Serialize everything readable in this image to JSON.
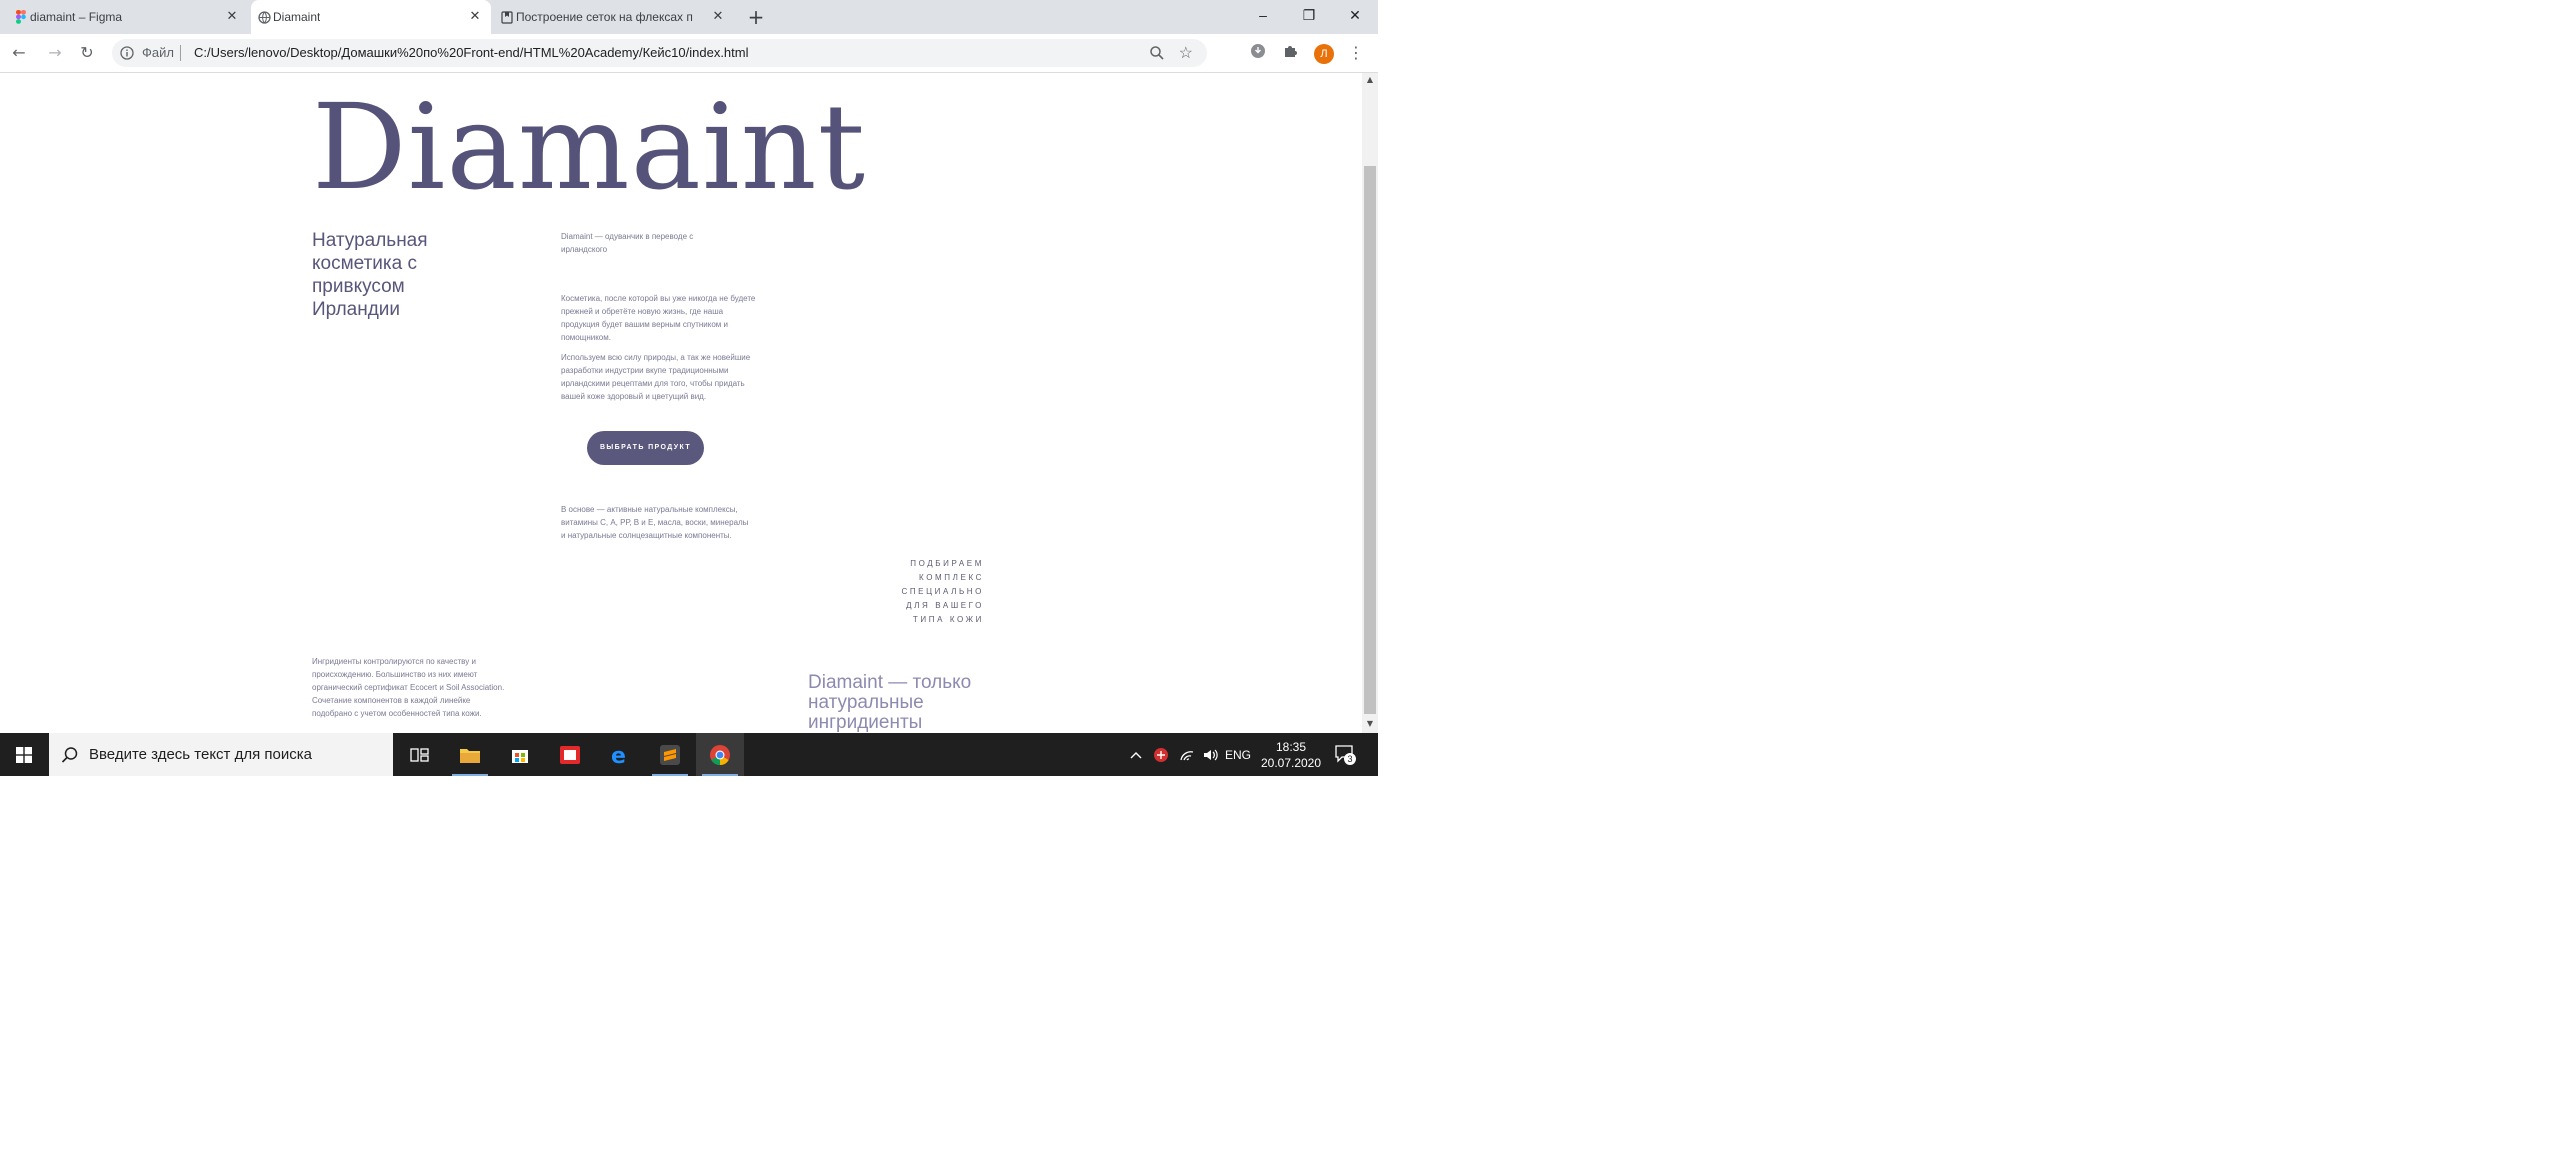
{
  "browser": {
    "tabs": [
      {
        "title": "diamaint – Figma",
        "active": false
      },
      {
        "title": "Diamaint",
        "active": true
      },
      {
        "title": "Построение сеток на флексах п",
        "active": false
      }
    ],
    "new_tab": "+",
    "window_controls": {
      "minimize": "–",
      "restore": "❐",
      "close": "✕"
    },
    "address": {
      "scheme_label": "Файл",
      "url": "C:/Users/lenovo/Desktop/Домашки%20по%20Front-end/HTML%20Academy/Кейс10/index.html"
    },
    "profile_initial": "Л"
  },
  "page": {
    "brand": "Diamaint",
    "tagline": "Натуральная косметика с привкусом Ирландии",
    "intro": "Diamaint — одуванчик в переводе с ирландского",
    "para1": "Косметика, после которой вы уже никогда не будете прежней и обретёте новую жизнь, где наша продукция будет вашим верным спутником и помощником.",
    "para2": "Используем всю силу природы, а так же новейшие разработки индустрии вкупе традиционными ирландскими рецептами для того, чтобы придать вашей коже здоровый и цветущий вид.",
    "cta_label": "ВЫБРАТЬ ПРОДУКТ",
    "para3": "В основе — активные натуральные комплексы, витамины С, А, РР, В и Е, масла, воски, минералы и натуральные солнцезащитные компоненты.",
    "selection_lines": [
      "ПОДБИРАЕМ",
      "КОМПЛЕКС",
      "СПЕЦИАЛЬНО",
      "ДЛЯ ВАШЕГО",
      "ТИПА КОЖИ"
    ],
    "para4": "Ингридиенты контролируются по качеству и происхождению. Большинство из них имеют органический сертификат Ecocert и Soil Association. Сочетание компонентов в каждой линейке подобрано с учетом особенностей типа кожи.",
    "bottom_title": "Diamaint — только натуральные ингридиенты"
  },
  "taskbar": {
    "search_placeholder": "Введите здесь текст для поиска",
    "language": "ENG",
    "time": "18:35",
    "date": "20.07.2020",
    "notification_count": "3"
  },
  "colors": {
    "brand": "#56537a",
    "button": "#5b587e",
    "accent_title": "#8d8ab0",
    "taskbar": "#1f1f1f",
    "tabstrip": "#dee1e6"
  }
}
